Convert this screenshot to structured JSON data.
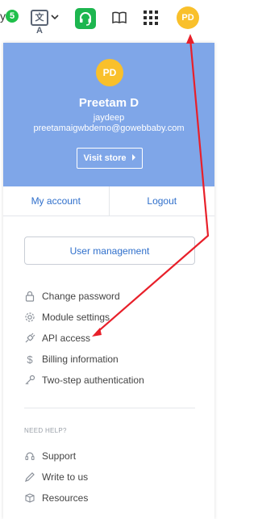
{
  "topbar": {
    "partial_text": "y",
    "notification_count": "5",
    "translate_glyph": "文A",
    "user_initials": "PD"
  },
  "profile": {
    "initials": "PD",
    "name": "Preetam D",
    "login": "jaydeep",
    "email": "preetamaigwbdemo@gowebbaby.com",
    "visit_store_label": "Visit store"
  },
  "account_links": {
    "my_account": "My account",
    "logout": "Logout"
  },
  "user_management_label": "User management",
  "menu": {
    "items": [
      {
        "label": "Change password",
        "icon": "lock-icon"
      },
      {
        "label": "Module settings",
        "icon": "gear-icon"
      },
      {
        "label": "API access",
        "icon": "plug-icon"
      },
      {
        "label": "Billing information",
        "icon": "dollar-icon"
      },
      {
        "label": "Two-step authentication",
        "icon": "key-icon"
      }
    ]
  },
  "help": {
    "heading": "NEED HELP?",
    "items": [
      {
        "label": "Support",
        "icon": "headset-icon"
      },
      {
        "label": "Write to us",
        "icon": "pencil-icon"
      },
      {
        "label": "Resources",
        "icon": "box-icon"
      }
    ]
  },
  "colors": {
    "accent_blue": "#2f6fcb",
    "header_blue": "#7fa6e8",
    "avatar_yellow": "#f9c02b",
    "support_green": "#1db64f",
    "annotation_red": "#e8202a"
  }
}
